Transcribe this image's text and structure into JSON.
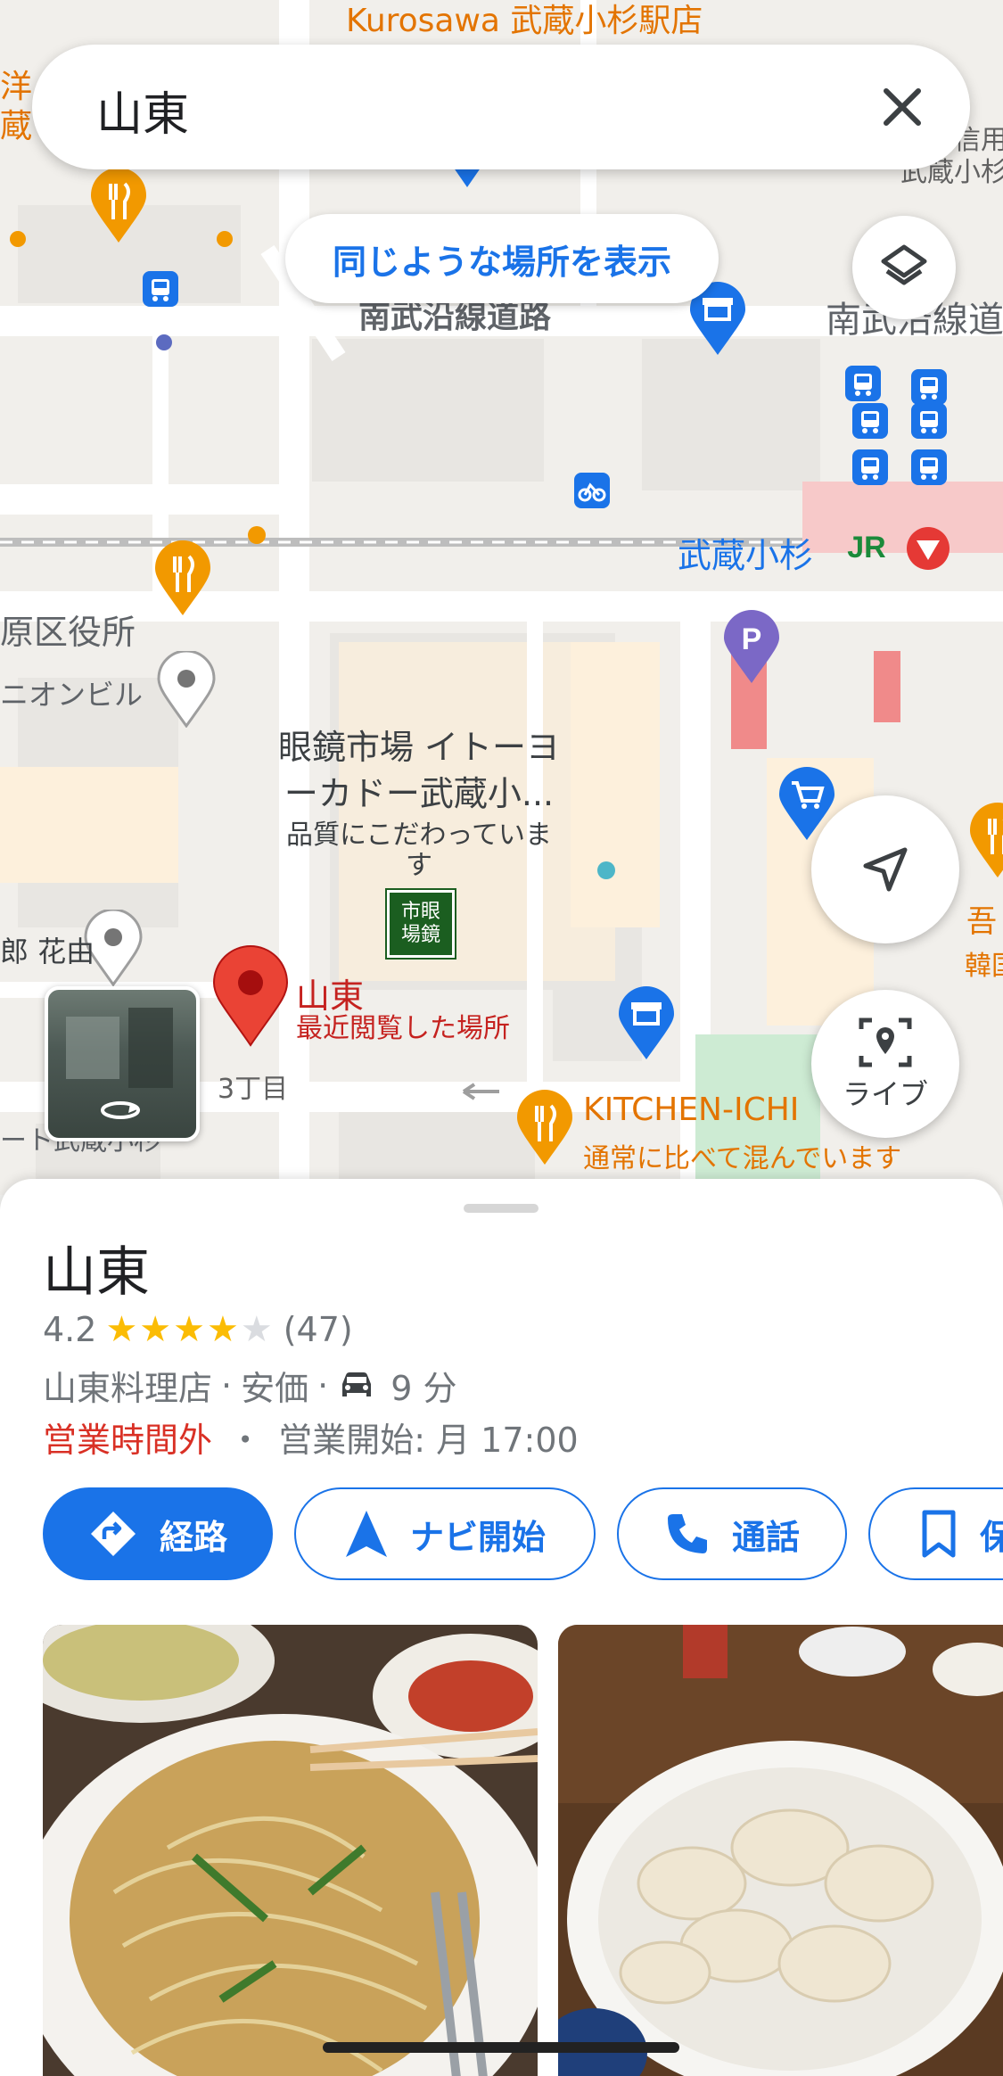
{
  "search": {
    "query": "山東",
    "close_icon": "close-icon"
  },
  "map": {
    "similar_places_button": "同じような場所を表示",
    "layers_icon": "layers-icon",
    "my_location_icon": "navigation-arrow-icon",
    "live_button_label": "ライブ",
    "labels": {
      "top_store": "Kurosawa 武蔵小杉駅店",
      "road_nambu_left": "南武沿線道路",
      "road_nambu_right": "南武沿線道",
      "station": "武蔵小杉",
      "ward_office": "原区役所",
      "union_building": "ニオンビル",
      "meganeichiba_line1": "眼鏡市場 イトーヨ",
      "meganeichiba_line2": "ーカドー武蔵小...",
      "meganeichiba_sub1": "品質にこだわっていま",
      "meganeichiba_sub2": "す",
      "hanada": "郎 花由",
      "block": "3丁目",
      "left_edge_1": "洋",
      "left_edge_2": "蔵",
      "right_edge_1": "信用",
      "right_edge_2": "武蔵小杉",
      "kitchen": "KITCHEN-ICHI",
      "kitchen_sub": "通常に比べて混んでいます",
      "bottom_left": "ート武蔵小杉",
      "right_go": "吾",
      "right_kan": "韓国",
      "pin_name": "山東",
      "pin_sub": "最近閲覧した場所",
      "megane_logo": "市眼場鏡",
      "parking": "P"
    },
    "colors": {
      "accent": "#1a73e8",
      "pin": "#ea4335",
      "food_icon": "#f29900",
      "label_red": "#c5221f",
      "transit": "#1a73e8"
    }
  },
  "place": {
    "name": "山東",
    "rating": "4.2",
    "rating_stars": 4.2,
    "review_count": "(47)",
    "category": "山東料理店",
    "price": "安価",
    "drive_time": "9 分",
    "status": "営業時間外",
    "separator": "・",
    "opens": "営業開始: 月 17:00",
    "dot": "·"
  },
  "actions": [
    {
      "label": "経路",
      "icon": "directions-icon"
    },
    {
      "label": "ナビ開始",
      "icon": "navigation-icon"
    },
    {
      "label": "通話",
      "icon": "phone-icon"
    },
    {
      "label": "保",
      "icon": "bookmark-icon"
    }
  ]
}
